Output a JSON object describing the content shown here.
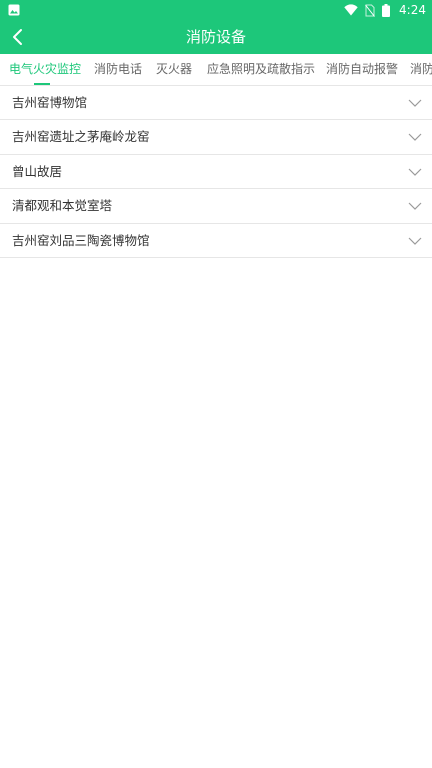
{
  "status_bar": {
    "time": "4:24",
    "icons": [
      "image-notification-icon",
      "wifi-icon",
      "no-sim-icon",
      "battery-icon"
    ]
  },
  "header": {
    "title": "消防设备",
    "back_icon": "chevron-left-icon"
  },
  "tabs": [
    {
      "label": "电气火灾监控",
      "active": true
    },
    {
      "label": "消防电话",
      "active": false
    },
    {
      "label": "灭火器",
      "active": false
    },
    {
      "label": "应急照明及疏散指示",
      "active": false
    },
    {
      "label": "消防自动报警",
      "active": false
    },
    {
      "label": "消防",
      "active": false
    }
  ],
  "list": {
    "items": [
      {
        "label": "吉州窑博物馆",
        "icon": "chevron-down-icon"
      },
      {
        "label": "吉州窑遗址之茅庵岭龙窑",
        "icon": "chevron-down-icon"
      },
      {
        "label": "曾山故居",
        "icon": "chevron-down-icon"
      },
      {
        "label": "清都观和本觉室塔",
        "icon": "chevron-down-icon"
      },
      {
        "label": "吉州窑刘品三陶瓷博物馆",
        "icon": "chevron-down-icon"
      }
    ]
  },
  "colors": {
    "accent": "#1dc77a",
    "text": "#333333",
    "tab_text": "#666666",
    "divider": "#e6e6e6"
  }
}
